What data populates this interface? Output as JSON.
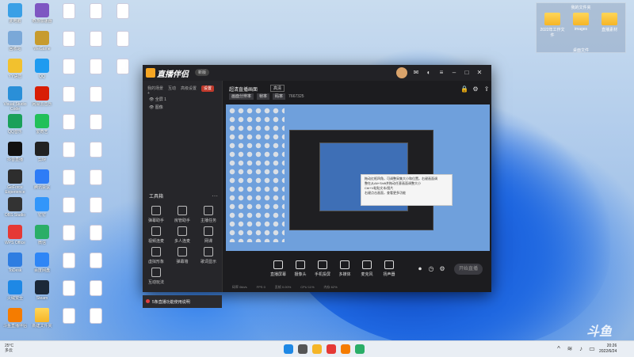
{
  "desktop": {
    "icons": [
      {
        "label": "此电脑",
        "kind": "app",
        "color": "#3aa0e6"
      },
      {
        "label": "回收站",
        "kind": "app",
        "color": "#7aa8d8"
      },
      {
        "label": "YY语音",
        "kind": "app",
        "color": "#f2c12e"
      },
      {
        "label": "Visual Studio Code",
        "kind": "app",
        "color": "#2a8fd8"
      },
      {
        "label": "QQ音乐",
        "kind": "app",
        "color": "#1aa05a"
      },
      {
        "label": "抖音直播",
        "kind": "app",
        "color": "#111111"
      },
      {
        "label": "GeForce Experience",
        "kind": "app",
        "color": "#2d2d2d"
      },
      {
        "label": "OBS Studio",
        "kind": "app",
        "color": "#333333"
      },
      {
        "label": "WPS Office",
        "kind": "app",
        "color": "#e53935"
      },
      {
        "label": "ToDesk",
        "kind": "app",
        "color": "#2f7de1"
      },
      {
        "label": "火绒安全",
        "kind": "app",
        "color": "#1e88e5"
      },
      {
        "label": "斗鱼直播伴侣",
        "kind": "app",
        "color": "#f57c00"
      },
      {
        "label": "奇游加速器",
        "kind": "app",
        "color": "#7e57c2"
      },
      {
        "label": "WeGame",
        "kind": "app",
        "color": "#c79b2e"
      },
      {
        "label": "QQ",
        "kind": "app",
        "color": "#1e9bf0"
      },
      {
        "label": "网易云音乐",
        "kind": "app",
        "color": "#d81e06"
      },
      {
        "label": "爱奇艺",
        "kind": "app",
        "color": "#22c05a"
      },
      {
        "label": "剪映",
        "kind": "app",
        "color": "#222222"
      },
      {
        "label": "腾讯会议",
        "kind": "app",
        "color": "#2e7cf6"
      },
      {
        "label": "钉钉",
        "kind": "app",
        "color": "#3296fa"
      },
      {
        "label": "微信",
        "kind": "app",
        "color": "#2aae67"
      },
      {
        "label": "百度网盘",
        "kind": "app",
        "color": "#2f86f6"
      },
      {
        "label": "Steam",
        "kind": "app",
        "color": "#1b2838"
      },
      {
        "label": "新建文件夹",
        "kind": "folder",
        "color": "#f5b527"
      }
    ],
    "right_group": {
      "title": "我的文件夹",
      "folders": [
        {
          "label": "2022年工作文件"
        },
        {
          "label": "images"
        },
        {
          "label": "直播素材"
        }
      ],
      "footer": "桌面文件"
    }
  },
  "app": {
    "name": "直播伴侣",
    "badge": "新版",
    "left_tabs": [
      "我的场景",
      "互动",
      "高级设置",
      "设置"
    ],
    "active_tab": "设置",
    "scene_rows": [
      "全屏 1",
      "图像"
    ],
    "tools_title": "工具箱",
    "tools": [
      {
        "label": "弹幕助手"
      },
      {
        "label": "房管助手"
      },
      {
        "label": "主播任务"
      },
      {
        "label": "视频连麦"
      },
      {
        "label": "多人连麦"
      },
      {
        "label": "网课"
      },
      {
        "label": "虚拟形象"
      },
      {
        "label": "弹幕墙"
      },
      {
        "label": "歌词显示"
      },
      {
        "label": "互动玩法"
      }
    ],
    "warning": "5条直播功能使用说明",
    "scene_name": "超清直播画面",
    "scene_badge": "高清",
    "tags": [
      "画面分辨率",
      "帧率",
      "码率"
    ],
    "counter": "7667325",
    "tip_lines": [
      "拖动红框四角，可调整采集大小和位置。右键画面调",
      "整在从Alt+Shift并拖动任意画面调整大小",
      "Ctrl+V粘贴文本/图片",
      "右键点击画面，查看更多功能"
    ],
    "bottom_buttons": [
      {
        "label": "直播屏幕"
      },
      {
        "label": "摄像头"
      },
      {
        "label": "手机投屏"
      },
      {
        "label": "多媒体"
      },
      {
        "label": "麦克风"
      },
      {
        "label": "扬声器"
      }
    ],
    "start_button": "开始直播",
    "status": [
      "码率 0kb/s",
      "FPS 0",
      "丢帧 0.00%",
      "CPU 11%",
      "内存 62%"
    ]
  },
  "taskbar": {
    "weather_temp": "25°C",
    "weather_desc": "多云",
    "time": "20:26",
    "date": "2022/6/24",
    "icons": [
      {
        "name": "windows-start",
        "color": "#1e88e5"
      },
      {
        "name": "search",
        "color": "#555555"
      },
      {
        "name": "file-explorer",
        "color": "#f5b527"
      },
      {
        "name": "chrome",
        "color": "#e53935"
      },
      {
        "name": "douyu-companion",
        "color": "#f57c00"
      },
      {
        "name": "wechat",
        "color": "#2aae67"
      }
    ]
  },
  "watermark": "斗鱼"
}
